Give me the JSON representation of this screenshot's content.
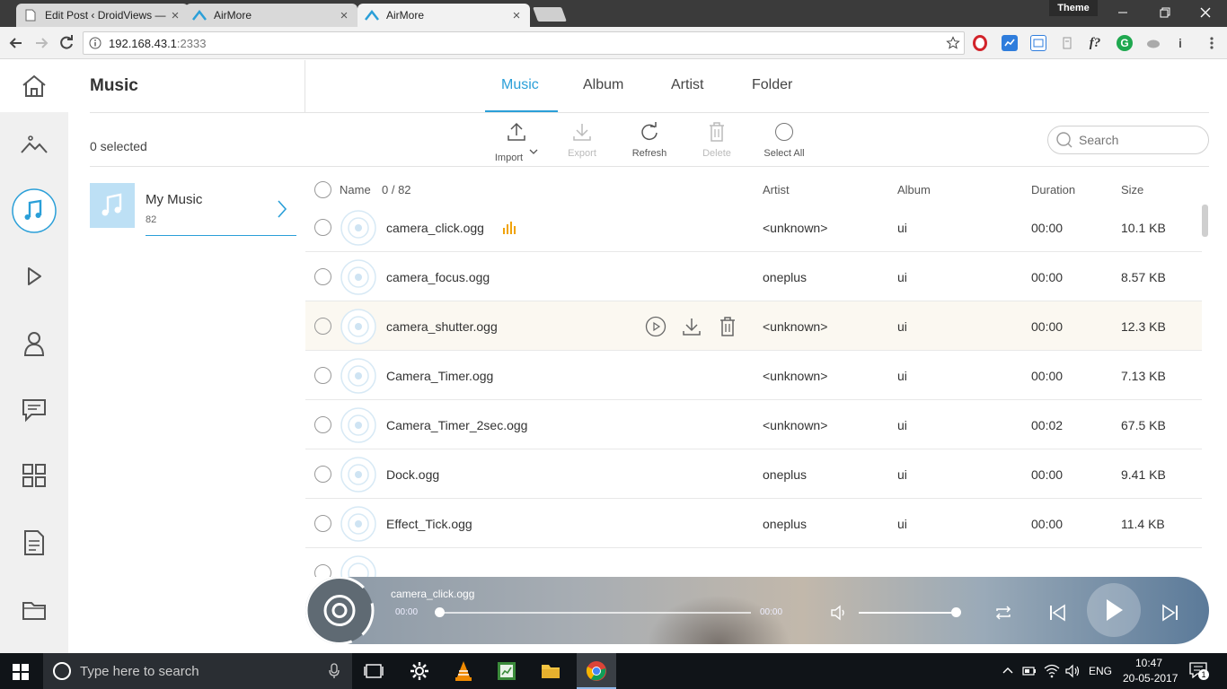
{
  "browser": {
    "tabs": [
      {
        "title": "Edit Post ‹ DroidViews —",
        "active": false
      },
      {
        "title": "AirMore",
        "active": false
      },
      {
        "title": "AirMore",
        "active": true
      }
    ],
    "close_glyph": "×",
    "theme_label": "Theme",
    "url_host": "192.168.43.1",
    "url_port": ":2333",
    "ext_labels": {
      "opera": "O",
      "fquestion": "f?",
      "g": "G",
      "i": "i"
    }
  },
  "app": {
    "page_title": "Music",
    "selected_count": "0 selected",
    "my_music": {
      "label": "My Music",
      "count": "82"
    },
    "tabs": [
      "Music",
      "Album",
      "Artist",
      "Folder"
    ],
    "toolbar": {
      "import": "Import",
      "export": "Export",
      "refresh": "Refresh",
      "delete": "Delete",
      "select_all": "Select All"
    },
    "search_placeholder": "Search",
    "table": {
      "headers": {
        "name": "Name",
        "count": "0 / 82",
        "artist": "Artist",
        "album": "Album",
        "duration": "Duration",
        "size": "Size"
      },
      "rows": [
        {
          "name": "camera_click.ogg",
          "artist": "<unknown>",
          "album": "ui",
          "duration": "00:00",
          "size": "10.1 KB"
        },
        {
          "name": "camera_focus.ogg",
          "artist": "oneplus",
          "album": "ui",
          "duration": "00:00",
          "size": "8.57 KB"
        },
        {
          "name": "camera_shutter.ogg",
          "artist": "<unknown>",
          "album": "ui",
          "duration": "00:00",
          "size": "12.3 KB"
        },
        {
          "name": "Camera_Timer.ogg",
          "artist": "<unknown>",
          "album": "ui",
          "duration": "00:00",
          "size": "7.13 KB"
        },
        {
          "name": "Camera_Timer_2sec.ogg",
          "artist": "<unknown>",
          "album": "ui",
          "duration": "00:02",
          "size": "67.5 KB"
        },
        {
          "name": "Dock.ogg",
          "artist": "oneplus",
          "album": "ui",
          "duration": "00:00",
          "size": "9.41 KB"
        },
        {
          "name": "Effect_Tick.ogg",
          "artist": "oneplus",
          "album": "ui",
          "duration": "00:00",
          "size": "11.4 KB"
        }
      ]
    },
    "player": {
      "title": "camera_click.ogg",
      "time_start": "00:00",
      "time_end": "00:00",
      "progress": 0,
      "volume": 1
    },
    "accent_color": "#2a9fd8"
  },
  "taskbar": {
    "search_placeholder": "Type here to search",
    "language": "ENG",
    "time": "10:47",
    "date": "20-05-2017",
    "notification_count": "1"
  }
}
